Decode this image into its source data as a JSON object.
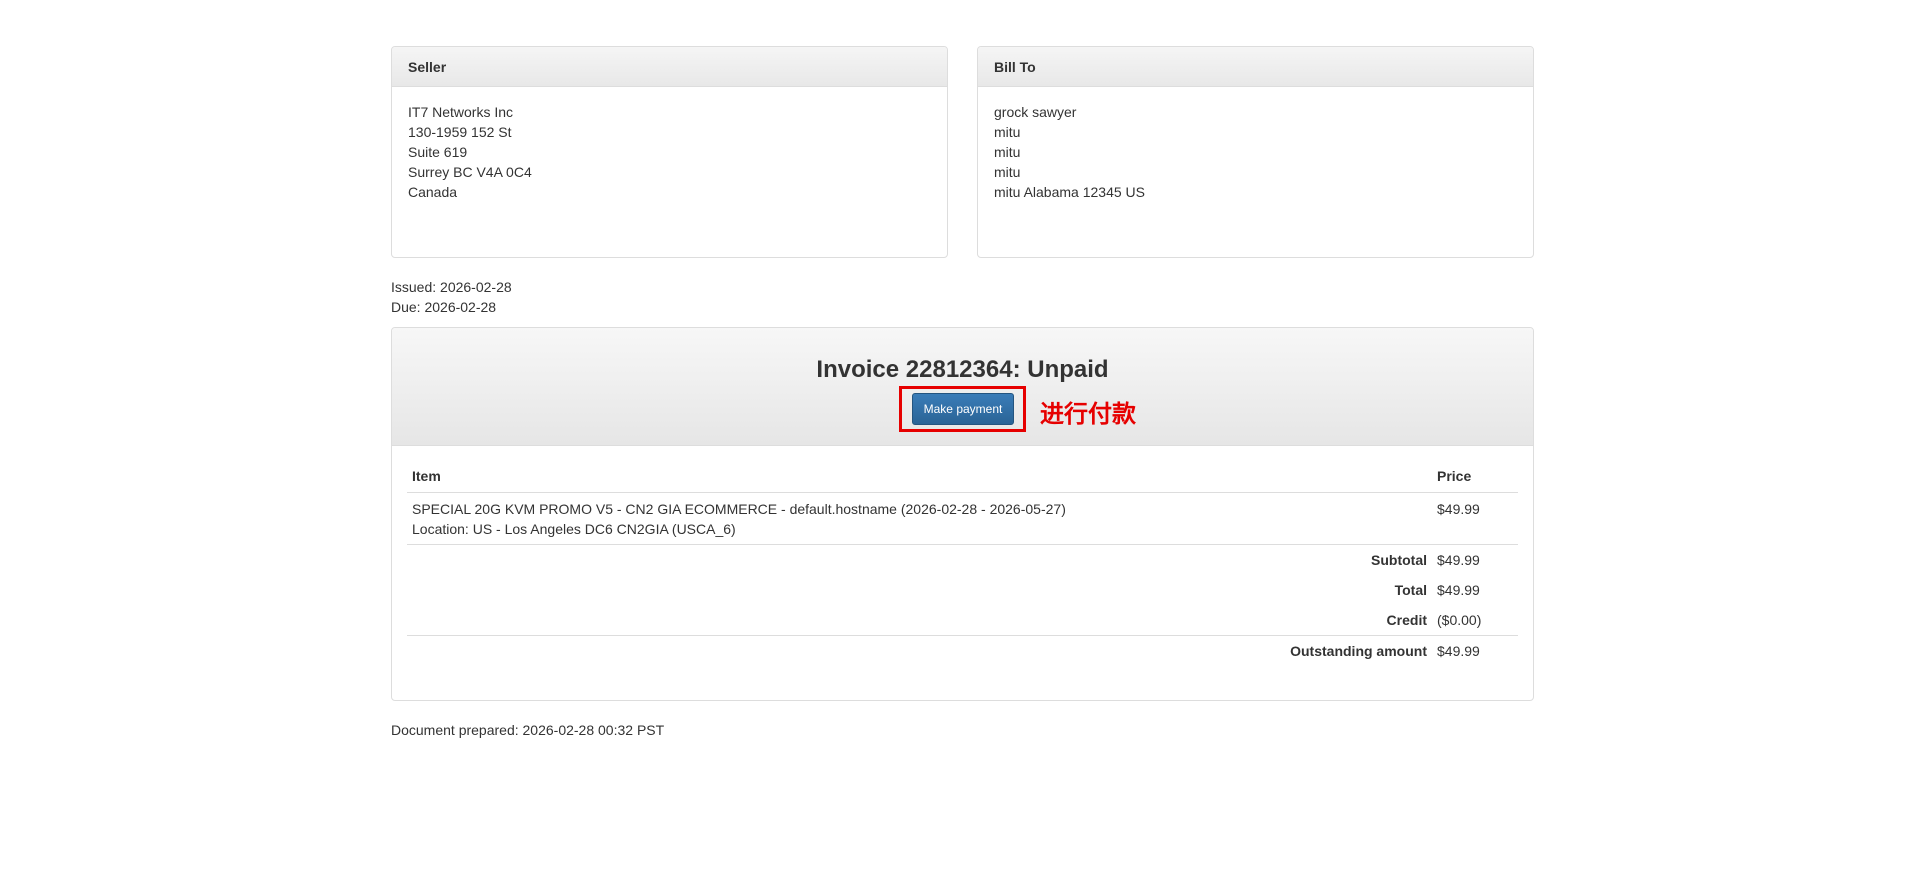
{
  "seller": {
    "heading": "Seller",
    "lines": [
      "IT7 Networks Inc",
      "130-1959 152 St",
      "Suite 619",
      "Surrey BC V4A 0C4",
      "Canada"
    ]
  },
  "bill_to": {
    "heading": "Bill To",
    "lines": [
      "grock sawyer",
      "mitu",
      "mitu",
      "mitu",
      "mitu Alabama 12345 US"
    ]
  },
  "dates": {
    "issued": "Issued: 2026-02-28",
    "due": "Due: 2026-02-28"
  },
  "invoice": {
    "title": "Invoice 22812364: Unpaid",
    "make_payment_label": "Make payment",
    "annotation": "进行付款",
    "annotation_color": "#e60000",
    "columns": {
      "item": "Item",
      "price": "Price"
    },
    "items": [
      {
        "line1": "SPECIAL 20G KVM PROMO V5 - CN2 GIA ECOMMERCE - default.hostname (2026-02-28 - 2026-05-27)",
        "line2": "Location: US - Los Angeles DC6 CN2GIA (USCA_6)",
        "price": "$49.99"
      }
    ],
    "summary": {
      "subtotal_label": "Subtotal",
      "subtotal": "$49.99",
      "total_label": "Total",
      "total": "$49.99",
      "credit_label": "Credit",
      "credit": "($0.00)",
      "outstanding_label": "Outstanding amount",
      "outstanding": "$49.99"
    }
  },
  "footer": {
    "prepared": "Document prepared: 2026-02-28 00:32 PST"
  },
  "colors": {
    "button": "#2a6496",
    "highlight": "#e60000"
  }
}
